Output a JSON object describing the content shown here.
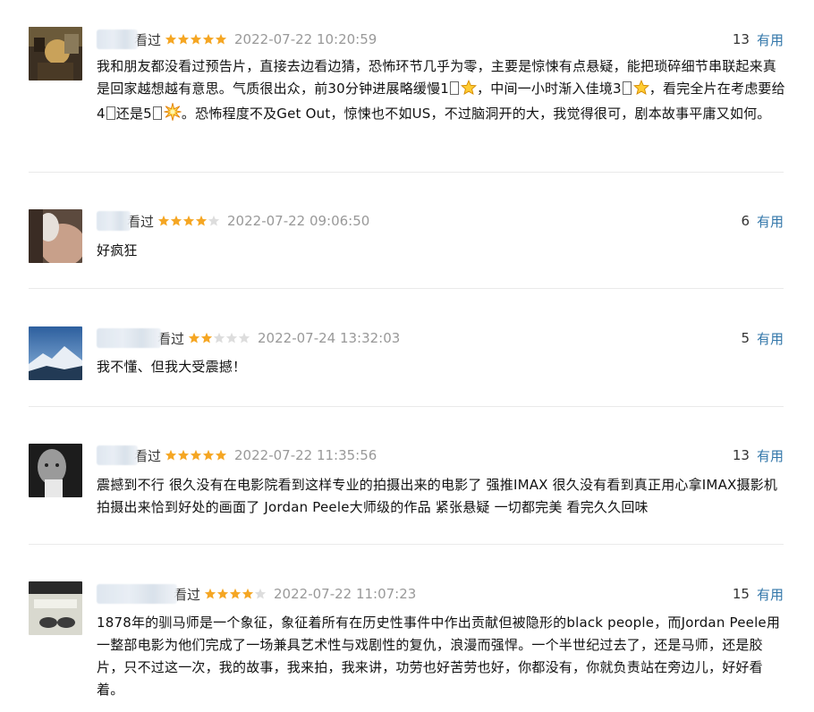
{
  "comments": [
    {
      "watched": "看过",
      "rating": 5,
      "date": "2022-07-22 10:20:59",
      "votes": "13",
      "useful": "有用",
      "avatar": "avatar-1",
      "content_parts": [
        "我和朋友都没看过预告片，直接去边看边猜，恐怖环节几乎为零，主要是惊悚有点悬疑，能把琐碎细节串联起来真是回家越想越有意思。气质很出众，前30分钟进展略缓慢1",
        "，中间一小时渐入佳境3",
        "，看完全片在考虑要给4",
        "还是5",
        "。恐怖程度不及Get Out，惊悚也不如US，不过脑洞开的大，我觉得很可，剧本故事平庸又如何。"
      ],
      "emoji_icons": [
        "star-emoji-icon",
        "star-emoji-icon",
        "sparkle-emoji-icon"
      ]
    },
    {
      "watched": "看过",
      "rating": 4,
      "date": "2022-07-22 09:06:50",
      "votes": "6",
      "useful": "有用",
      "avatar": "avatar-2",
      "content": "好疯狂"
    },
    {
      "watched": "看过",
      "rating": 2,
      "date": "2022-07-24 13:32:03",
      "votes": "5",
      "useful": "有用",
      "avatar": "avatar-3",
      "content": "我不懂、但我大受震撼！"
    },
    {
      "watched": "看过",
      "rating": 5,
      "date": "2022-07-22 11:35:56",
      "votes": "13",
      "useful": "有用",
      "avatar": "avatar-4",
      "content": "震撼到不行 很久没有在电影院看到这样专业的拍摄出来的电影了 强推IMAX 很久没有看到真正用心拿IMAX摄影机拍摄出来恰到好处的画面了 Jordan Peele大师级的作品 紧张悬疑 一切都完美 看完久久回味"
    },
    {
      "watched": "看过",
      "rating": 4,
      "date": "2022-07-22 11:07:23",
      "votes": "15",
      "useful": "有用",
      "avatar": "avatar-5",
      "content": "1878年的驯马师是一个象征，象征着所有在历史性事件中作出贡献但被隐形的black people，而Jordan Peele用一整部电影为他们完成了一场兼具艺术性与戏剧性的复仇，浪漫而强悍。一个半世纪过去了，还是马师，还是胶片，只不过这一次，我的故事，我来拍，我来讲，功劳也好苦劳也好，你都没有，你就负责站在旁边儿，好好看着。"
    }
  ],
  "colors": {
    "star_on": "#f5a623",
    "star_off": "#dddddd",
    "link": "#3377aa",
    "date": "#999999",
    "divider": "#eaeaea"
  }
}
